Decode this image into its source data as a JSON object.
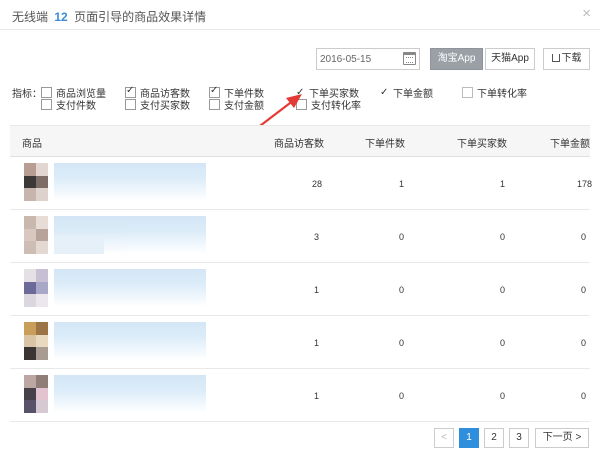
{
  "header": {
    "title_prefix": "无线端",
    "title_count": "12",
    "title_suffix": "页面引导的商品效果详情"
  },
  "toolbar": {
    "date_value": "2016-05-15",
    "app_active_label": "淘宝App",
    "app_other_label": "天猫App",
    "download_label": "下载"
  },
  "metrics": {
    "label": "指标：",
    "items": [
      {
        "label": "商品浏览量",
        "checked": false
      },
      {
        "label": "商品访客数",
        "checked": true
      },
      {
        "label": "下单件数",
        "checked": true
      },
      {
        "label": "下单买家数",
        "checked": true
      },
      {
        "label": "下单金额",
        "checked": true
      },
      {
        "label": "下单转化率",
        "checked": false
      },
      {
        "label": "支付件数",
        "checked": false
      },
      {
        "label": "支付买家数",
        "checked": false
      },
      {
        "label": "支付金额",
        "checked": false
      },
      {
        "label": "支付转化率",
        "checked": false
      }
    ]
  },
  "table": {
    "columns": [
      "商品",
      "商品访客数",
      "下单件数",
      "下单买家数",
      "下单金额"
    ],
    "rows": [
      {
        "visitors": "28",
        "order_items": "1",
        "order_buyers": "1",
        "order_amount": "178"
      },
      {
        "visitors": "3",
        "order_items": "0",
        "order_buyers": "0",
        "order_amount": "0"
      },
      {
        "visitors": "1",
        "order_items": "0",
        "order_buyers": "0",
        "order_amount": "0"
      },
      {
        "visitors": "1",
        "order_items": "0",
        "order_buyers": "0",
        "order_amount": "0"
      },
      {
        "visitors": "1",
        "order_items": "0",
        "order_buyers": "0",
        "order_amount": "0"
      }
    ]
  },
  "pagination": {
    "prev": "<",
    "pages": [
      "1",
      "2",
      "3"
    ],
    "next_label": "下一页",
    "next_arrow": ">"
  },
  "colors": {
    "accent": "#2f8fdd",
    "arrow": "#e53935",
    "title_count": "#3b8ad9"
  },
  "icons": {
    "close": "close-icon",
    "calendar": "calendar-icon",
    "download": "download-icon",
    "annotation": "red-arrow-icon"
  }
}
